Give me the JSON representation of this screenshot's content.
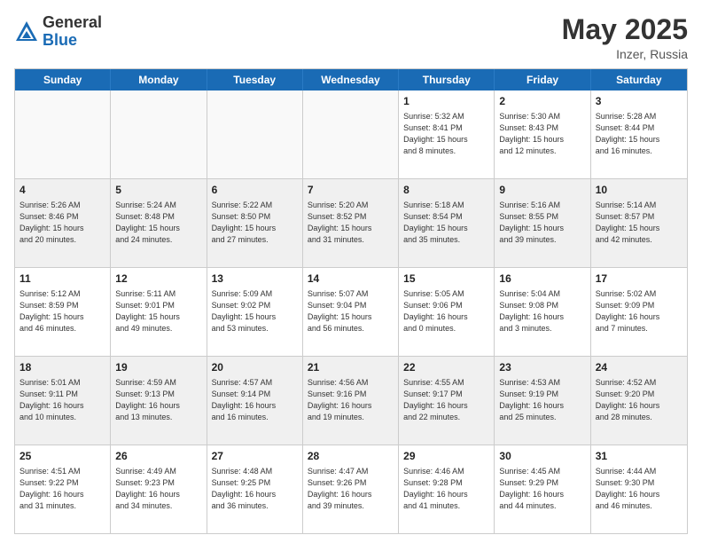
{
  "header": {
    "logo_general": "General",
    "logo_blue": "Blue",
    "month_year": "May 2025",
    "location": "Inzer, Russia"
  },
  "days_of_week": [
    "Sunday",
    "Monday",
    "Tuesday",
    "Wednesday",
    "Thursday",
    "Friday",
    "Saturday"
  ],
  "rows": [
    [
      {
        "num": "",
        "info": "",
        "empty": true
      },
      {
        "num": "",
        "info": "",
        "empty": true
      },
      {
        "num": "",
        "info": "",
        "empty": true
      },
      {
        "num": "",
        "info": "",
        "empty": true
      },
      {
        "num": "1",
        "info": "Sunrise: 5:32 AM\nSunset: 8:41 PM\nDaylight: 15 hours\nand 8 minutes.",
        "empty": false
      },
      {
        "num": "2",
        "info": "Sunrise: 5:30 AM\nSunset: 8:43 PM\nDaylight: 15 hours\nand 12 minutes.",
        "empty": false
      },
      {
        "num": "3",
        "info": "Sunrise: 5:28 AM\nSunset: 8:44 PM\nDaylight: 15 hours\nand 16 minutes.",
        "empty": false
      }
    ],
    [
      {
        "num": "4",
        "info": "Sunrise: 5:26 AM\nSunset: 8:46 PM\nDaylight: 15 hours\nand 20 minutes.",
        "empty": false
      },
      {
        "num": "5",
        "info": "Sunrise: 5:24 AM\nSunset: 8:48 PM\nDaylight: 15 hours\nand 24 minutes.",
        "empty": false
      },
      {
        "num": "6",
        "info": "Sunrise: 5:22 AM\nSunset: 8:50 PM\nDaylight: 15 hours\nand 27 minutes.",
        "empty": false
      },
      {
        "num": "7",
        "info": "Sunrise: 5:20 AM\nSunset: 8:52 PM\nDaylight: 15 hours\nand 31 minutes.",
        "empty": false
      },
      {
        "num": "8",
        "info": "Sunrise: 5:18 AM\nSunset: 8:54 PM\nDaylight: 15 hours\nand 35 minutes.",
        "empty": false
      },
      {
        "num": "9",
        "info": "Sunrise: 5:16 AM\nSunset: 8:55 PM\nDaylight: 15 hours\nand 39 minutes.",
        "empty": false
      },
      {
        "num": "10",
        "info": "Sunrise: 5:14 AM\nSunset: 8:57 PM\nDaylight: 15 hours\nand 42 minutes.",
        "empty": false
      }
    ],
    [
      {
        "num": "11",
        "info": "Sunrise: 5:12 AM\nSunset: 8:59 PM\nDaylight: 15 hours\nand 46 minutes.",
        "empty": false
      },
      {
        "num": "12",
        "info": "Sunrise: 5:11 AM\nSunset: 9:01 PM\nDaylight: 15 hours\nand 49 minutes.",
        "empty": false
      },
      {
        "num": "13",
        "info": "Sunrise: 5:09 AM\nSunset: 9:02 PM\nDaylight: 15 hours\nand 53 minutes.",
        "empty": false
      },
      {
        "num": "14",
        "info": "Sunrise: 5:07 AM\nSunset: 9:04 PM\nDaylight: 15 hours\nand 56 minutes.",
        "empty": false
      },
      {
        "num": "15",
        "info": "Sunrise: 5:05 AM\nSunset: 9:06 PM\nDaylight: 16 hours\nand 0 minutes.",
        "empty": false
      },
      {
        "num": "16",
        "info": "Sunrise: 5:04 AM\nSunset: 9:08 PM\nDaylight: 16 hours\nand 3 minutes.",
        "empty": false
      },
      {
        "num": "17",
        "info": "Sunrise: 5:02 AM\nSunset: 9:09 PM\nDaylight: 16 hours\nand 7 minutes.",
        "empty": false
      }
    ],
    [
      {
        "num": "18",
        "info": "Sunrise: 5:01 AM\nSunset: 9:11 PM\nDaylight: 16 hours\nand 10 minutes.",
        "empty": false
      },
      {
        "num": "19",
        "info": "Sunrise: 4:59 AM\nSunset: 9:13 PM\nDaylight: 16 hours\nand 13 minutes.",
        "empty": false
      },
      {
        "num": "20",
        "info": "Sunrise: 4:57 AM\nSunset: 9:14 PM\nDaylight: 16 hours\nand 16 minutes.",
        "empty": false
      },
      {
        "num": "21",
        "info": "Sunrise: 4:56 AM\nSunset: 9:16 PM\nDaylight: 16 hours\nand 19 minutes.",
        "empty": false
      },
      {
        "num": "22",
        "info": "Sunrise: 4:55 AM\nSunset: 9:17 PM\nDaylight: 16 hours\nand 22 minutes.",
        "empty": false
      },
      {
        "num": "23",
        "info": "Sunrise: 4:53 AM\nSunset: 9:19 PM\nDaylight: 16 hours\nand 25 minutes.",
        "empty": false
      },
      {
        "num": "24",
        "info": "Sunrise: 4:52 AM\nSunset: 9:20 PM\nDaylight: 16 hours\nand 28 minutes.",
        "empty": false
      }
    ],
    [
      {
        "num": "25",
        "info": "Sunrise: 4:51 AM\nSunset: 9:22 PM\nDaylight: 16 hours\nand 31 minutes.",
        "empty": false
      },
      {
        "num": "26",
        "info": "Sunrise: 4:49 AM\nSunset: 9:23 PM\nDaylight: 16 hours\nand 34 minutes.",
        "empty": false
      },
      {
        "num": "27",
        "info": "Sunrise: 4:48 AM\nSunset: 9:25 PM\nDaylight: 16 hours\nand 36 minutes.",
        "empty": false
      },
      {
        "num": "28",
        "info": "Sunrise: 4:47 AM\nSunset: 9:26 PM\nDaylight: 16 hours\nand 39 minutes.",
        "empty": false
      },
      {
        "num": "29",
        "info": "Sunrise: 4:46 AM\nSunset: 9:28 PM\nDaylight: 16 hours\nand 41 minutes.",
        "empty": false
      },
      {
        "num": "30",
        "info": "Sunrise: 4:45 AM\nSunset: 9:29 PM\nDaylight: 16 hours\nand 44 minutes.",
        "empty": false
      },
      {
        "num": "31",
        "info": "Sunrise: 4:44 AM\nSunset: 9:30 PM\nDaylight: 16 hours\nand 46 minutes.",
        "empty": false
      }
    ]
  ]
}
